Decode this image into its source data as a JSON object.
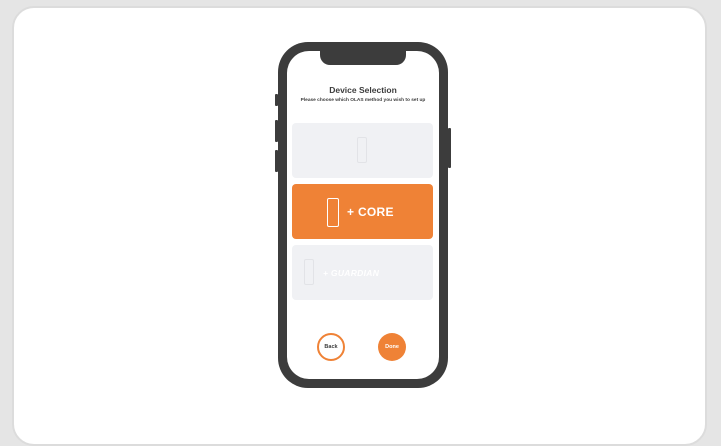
{
  "screen": {
    "title": "Device Selection",
    "subtitle": "Please choose which OLAS method you wish to set up"
  },
  "options": [
    {
      "name": "blank",
      "label": "",
      "selected": false
    },
    {
      "name": "core",
      "label": "+ CORE",
      "selected": true
    },
    {
      "name": "guardian",
      "label": "+ GUARDIAN",
      "selected": false
    }
  ],
  "buttons": {
    "back_label": "Back",
    "done_label": "Done"
  },
  "colors": {
    "accent": "#ef8236",
    "card_grey": "#f0f1f4",
    "phone_body": "#3c3c3c"
  }
}
